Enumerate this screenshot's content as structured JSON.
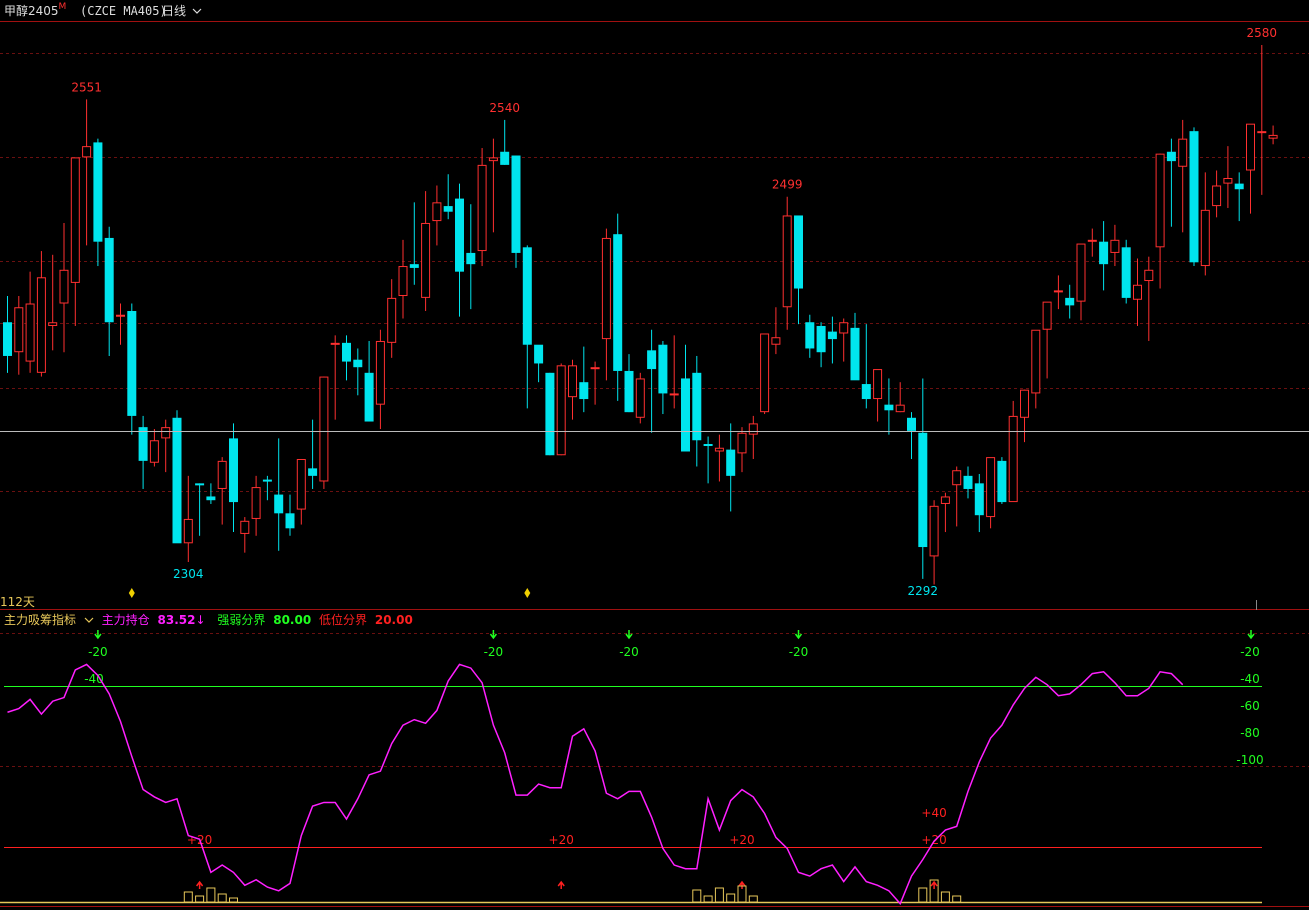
{
  "header": {
    "symbol": "甲醇2405",
    "badge": "M",
    "code": "(CZCE MA405)",
    "period": "日线"
  },
  "days_label": "112天",
  "indicator": {
    "name": "主力吸筹指标",
    "items": [
      {
        "label": "主力持仓",
        "value": "83.52",
        "arrow": "↓",
        "color": "#ff20ff"
      },
      {
        "label": "强弱分界",
        "value": "80.00",
        "color": "#20ff20"
      },
      {
        "label": "低位分界",
        "value": "20.00",
        "color": "#ff2020"
      }
    ],
    "levels": [
      -20,
      -40,
      -60,
      -80,
      -100
    ],
    "upper_line_label": "-40",
    "lower_line_label": "+20"
  },
  "colors": {
    "up": "#ff3030",
    "down": "#00e5ee",
    "line": "#ff20ff",
    "green": "#20ff20",
    "yellow": "#e8c85a"
  },
  "chart_data": [
    {
      "type": "candlestick",
      "title": "",
      "ohlc": [
        [
          2432,
          2446,
          2405,
          2414
        ],
        [
          2416,
          2446,
          2404,
          2440
        ],
        [
          2411,
          2459,
          2405,
          2442
        ],
        [
          2405,
          2470,
          2403,
          2456
        ],
        [
          2430,
          2468,
          2417,
          2432
        ],
        [
          2442,
          2485,
          2416,
          2460
        ],
        [
          2453,
          2495,
          2430,
          2520
        ],
        [
          2520,
          2551,
          2473,
          2526
        ],
        [
          2528,
          2530,
          2462,
          2475
        ],
        [
          2477,
          2483,
          2414,
          2432
        ],
        [
          2435,
          2442,
          2420,
          2436
        ],
        [
          2438,
          2442,
          2372,
          2382
        ],
        [
          2376,
          2382,
          2343,
          2358
        ],
        [
          2357,
          2375,
          2355,
          2369
        ],
        [
          2370,
          2380,
          2352,
          2376
        ],
        [
          2381,
          2385,
          2349,
          2314
        ],
        [
          2314,
          2350,
          2304,
          2327
        ],
        [
          2346,
          2346,
          2318,
          2345
        ],
        [
          2339,
          2346,
          2335,
          2337
        ],
        [
          2343,
          2360,
          2324,
          2358
        ],
        [
          2370,
          2378,
          2320,
          2336
        ],
        [
          2319,
          2328,
          2309,
          2326
        ],
        [
          2327,
          2350,
          2318,
          2344
        ],
        [
          2348,
          2350,
          2337,
          2347
        ],
        [
          2340,
          2370,
          2310,
          2330
        ],
        [
          2330,
          2340,
          2318,
          2322
        ],
        [
          2332,
          2353,
          2324,
          2359
        ],
        [
          2354,
          2380,
          2343,
          2350
        ],
        [
          2347,
          2403,
          2343,
          2403
        ],
        [
          2420,
          2425,
          2380,
          2421
        ],
        [
          2421,
          2425,
          2401,
          2411
        ],
        [
          2412,
          2418,
          2393,
          2408
        ],
        [
          2405,
          2422,
          2379,
          2379
        ],
        [
          2388,
          2428,
          2375,
          2422
        ],
        [
          2421,
          2455,
          2413,
          2445
        ],
        [
          2446,
          2476,
          2434,
          2462
        ],
        [
          2463,
          2496,
          2452,
          2461
        ],
        [
          2445,
          2502,
          2438,
          2485
        ],
        [
          2486,
          2505,
          2473,
          2496
        ],
        [
          2494,
          2511,
          2487,
          2491
        ],
        [
          2498,
          2506,
          2435,
          2459
        ],
        [
          2469,
          2495,
          2439,
          2463
        ],
        [
          2470,
          2525,
          2462,
          2516
        ],
        [
          2518,
          2530,
          2480,
          2520
        ],
        [
          2523,
          2540,
          2516,
          2516
        ],
        [
          2521,
          2521,
          2461,
          2469
        ],
        [
          2472,
          2473,
          2386,
          2420
        ],
        [
          2420,
          2415,
          2400,
          2410
        ],
        [
          2405,
          2405,
          2361,
          2361
        ],
        [
          2361,
          2410,
          2361,
          2409
        ],
        [
          2392,
          2412,
          2380,
          2409
        ],
        [
          2400,
          2419,
          2384,
          2391
        ],
        [
          2408,
          2411,
          2388,
          2408
        ],
        [
          2423,
          2482,
          2401,
          2477
        ],
        [
          2479,
          2490,
          2390,
          2406
        ],
        [
          2406,
          2415,
          2384,
          2384
        ],
        [
          2381,
          2405,
          2378,
          2402
        ],
        [
          2417,
          2428,
          2373,
          2407
        ],
        [
          2420,
          2422,
          2383,
          2394
        ],
        [
          2394,
          2425,
          2386,
          2394
        ],
        [
          2402,
          2420,
          2364,
          2363
        ],
        [
          2405,
          2414,
          2355,
          2369
        ],
        [
          2367,
          2371,
          2346,
          2366
        ],
        [
          2363,
          2372,
          2347,
          2365
        ],
        [
          2364,
          2378,
          2331,
          2350
        ],
        [
          2362,
          2376,
          2352,
          2373
        ],
        [
          2372,
          2382,
          2359,
          2378
        ],
        [
          2384,
          2420,
          2383,
          2426
        ],
        [
          2420,
          2440,
          2415,
          2424
        ],
        [
          2440,
          2499,
          2428,
          2489
        ],
        [
          2489,
          2489,
          2431,
          2450
        ],
        [
          2432,
          2436,
          2413,
          2418
        ],
        [
          2430,
          2432,
          2408,
          2416
        ],
        [
          2427,
          2435,
          2410,
          2423
        ],
        [
          2426,
          2434,
          2411,
          2432
        ],
        [
          2429,
          2437,
          2407,
          2401
        ],
        [
          2399,
          2431,
          2386,
          2391
        ],
        [
          2391,
          2402,
          2379,
          2407
        ],
        [
          2388,
          2402,
          2372,
          2385
        ],
        [
          2384,
          2400,
          2384,
          2388
        ],
        [
          2381,
          2384,
          2359,
          2374
        ],
        [
          2373,
          2402,
          2295,
          2312
        ],
        [
          2307,
          2337,
          2292,
          2334
        ],
        [
          2335,
          2341,
          2320,
          2339
        ],
        [
          2345,
          2355,
          2323,
          2353
        ],
        [
          2350,
          2355,
          2338,
          2343
        ],
        [
          2346,
          2351,
          2320,
          2329
        ],
        [
          2328,
          2353,
          2322,
          2360
        ],
        [
          2358,
          2360,
          2335,
          2336
        ],
        [
          2336,
          2390,
          2345,
          2382
        ],
        [
          2381,
          2396,
          2368,
          2396
        ],
        [
          2394,
          2419,
          2386,
          2428
        ],
        [
          2428,
          2442,
          2402,
          2443
        ],
        [
          2448,
          2457,
          2439,
          2449
        ],
        [
          2445,
          2452,
          2434,
          2441
        ],
        [
          2443,
          2473,
          2433,
          2474
        ],
        [
          2475,
          2482,
          2467,
          2476
        ],
        [
          2475,
          2486,
          2449,
          2463
        ],
        [
          2469,
          2484,
          2462,
          2476
        ],
        [
          2472,
          2476,
          2442,
          2445
        ],
        [
          2444,
          2466,
          2430,
          2452
        ],
        [
          2454,
          2467,
          2422,
          2460
        ],
        [
          2472,
          2522,
          2450,
          2522
        ],
        [
          2523,
          2530,
          2483,
          2518
        ],
        [
          2515,
          2540,
          2480,
          2530
        ],
        [
          2534,
          2536,
          2462,
          2464
        ],
        [
          2462,
          2512,
          2457,
          2492
        ],
        [
          2494,
          2513,
          2488,
          2505
        ],
        [
          2506,
          2526,
          2493,
          2509
        ],
        [
          2506,
          2512,
          2486,
          2503
        ],
        [
          2513,
          2536,
          2490,
          2538
        ],
        [
          2533,
          2580,
          2500,
          2534
        ],
        [
          2530,
          2537,
          2527,
          2532
        ]
      ],
      "annotations": {
        "max_left": {
          "value": "2551",
          "index": 7
        },
        "max_mid": {
          "value": "2540",
          "index": 44
        },
        "max_r": {
          "value": "2499",
          "index": 69
        },
        "max_right": {
          "value": "2580",
          "index": 111
        },
        "min_left": {
          "value": "2304",
          "index": 16
        },
        "min_right": {
          "value": "2292",
          "index": 81
        }
      },
      "ylim": [
        2288,
        2588
      ]
    },
    {
      "type": "line",
      "title": "",
      "series": [
        {
          "values": [
            -56,
            -54,
            -49,
            -57,
            -50,
            -48,
            -33,
            -30,
            -36,
            -46,
            -61,
            -80,
            -98,
            -102,
            -105,
            -103,
            -123,
            -125,
            -143,
            -139,
            -143,
            -150,
            -147,
            -151,
            -153,
            -149,
            -123,
            -107,
            -105,
            -105,
            -114,
            -103,
            -90,
            -88,
            -73,
            -63,
            -60,
            -62,
            -55,
            -39,
            -30,
            -32,
            -40,
            -63,
            -78,
            -101,
            -101,
            -95,
            -97,
            -97,
            -69,
            -65,
            -77,
            -100,
            -103,
            -99,
            -99,
            -113,
            -130,
            -139,
            -141,
            -141,
            -103,
            -120,
            -104,
            -98,
            -102,
            -111,
            -124,
            -130,
            -143,
            -145,
            -141,
            -139,
            -148,
            -140,
            -148,
            -150,
            -153,
            -160,
            -145,
            -136,
            -126,
            -120,
            -118,
            -99,
            -83,
            -70,
            -63,
            -52,
            -43,
            -37,
            -41,
            -47,
            -46,
            -41,
            -35,
            -34,
            -40,
            -47,
            -47,
            -43,
            -34,
            -35,
            -41
          ]
        }
      ],
      "ylim": [
        -158,
        -20
      ]
    }
  ]
}
